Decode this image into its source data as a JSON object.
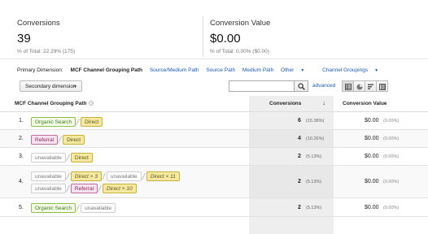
{
  "summary": {
    "conversions": {
      "label": "Conversions",
      "value": "39",
      "total": "% of Total: 22.29% (175)"
    },
    "conversion_value": {
      "label": "Conversion Value",
      "value": "$0.00",
      "total": "% of Total: 0.00% ($0.00)"
    }
  },
  "dimension_bar": {
    "label": "Primary Dimension:",
    "current": "MCF Channel Grouping Path",
    "links": [
      "Source/Medium Path",
      "Source Path",
      "Medium Path"
    ],
    "other": "Other",
    "channel_groupings": "Channel Groupings"
  },
  "toolbar": {
    "secondary_dimension": "Secondary dimension",
    "search_placeholder": "",
    "advanced": "advanced"
  },
  "table": {
    "headers": {
      "path": "MCF Channel Grouping Path",
      "help": "?",
      "conversions": "Conversions",
      "sort": "↓",
      "conversion_value": "Conversion Value"
    },
    "rows": [
      {
        "num": "1.",
        "lines": [
          [
            {
              "text": "Organic Search",
              "type": "organic"
            },
            {
              "text": "Direct",
              "type": "direct"
            }
          ]
        ],
        "conv": "6",
        "conv_pct": "(15.38%)",
        "val": "$0.00",
        "val_pct": "(0.00%)"
      },
      {
        "num": "2.",
        "lines": [
          [
            {
              "text": "Referral",
              "type": "referral"
            },
            {
              "text": "Direct",
              "type": "direct"
            }
          ]
        ],
        "conv": "4",
        "conv_pct": "(10.26%)",
        "val": "$0.00",
        "val_pct": "(0.00%)"
      },
      {
        "num": "3.",
        "lines": [
          [
            {
              "text": "unavailable",
              "type": "unavailable"
            },
            {
              "text": "Direct",
              "type": "direct"
            }
          ]
        ],
        "conv": "2",
        "conv_pct": "(5.13%)",
        "val": "$0.00",
        "val_pct": "(0.00%)"
      },
      {
        "num": "4.",
        "lines": [
          [
            {
              "text": "unavailable",
              "type": "unavailable"
            },
            {
              "text": "Direct × 3",
              "type": "direct"
            },
            {
              "text": "unavailable",
              "type": "unavailable"
            },
            {
              "text": "Direct × 11",
              "type": "direct"
            }
          ],
          [
            {
              "text": "unavailable",
              "type": "unavailable"
            },
            {
              "text": "Referral",
              "type": "referral"
            },
            {
              "text": "Direct × 10",
              "type": "direct"
            }
          ]
        ],
        "conv": "2",
        "conv_pct": "(5.13%)",
        "val": "$0.00",
        "val_pct": "(0.00%)"
      },
      {
        "num": "5.",
        "lines": [
          [
            {
              "text": "Organic Search",
              "type": "organic"
            },
            {
              "text": "unavailable",
              "type": "unavailable"
            }
          ]
        ],
        "conv": "2",
        "conv_pct": "(5.13%)",
        "val": "$0.00",
        "val_pct": "(0.00%)"
      }
    ]
  }
}
